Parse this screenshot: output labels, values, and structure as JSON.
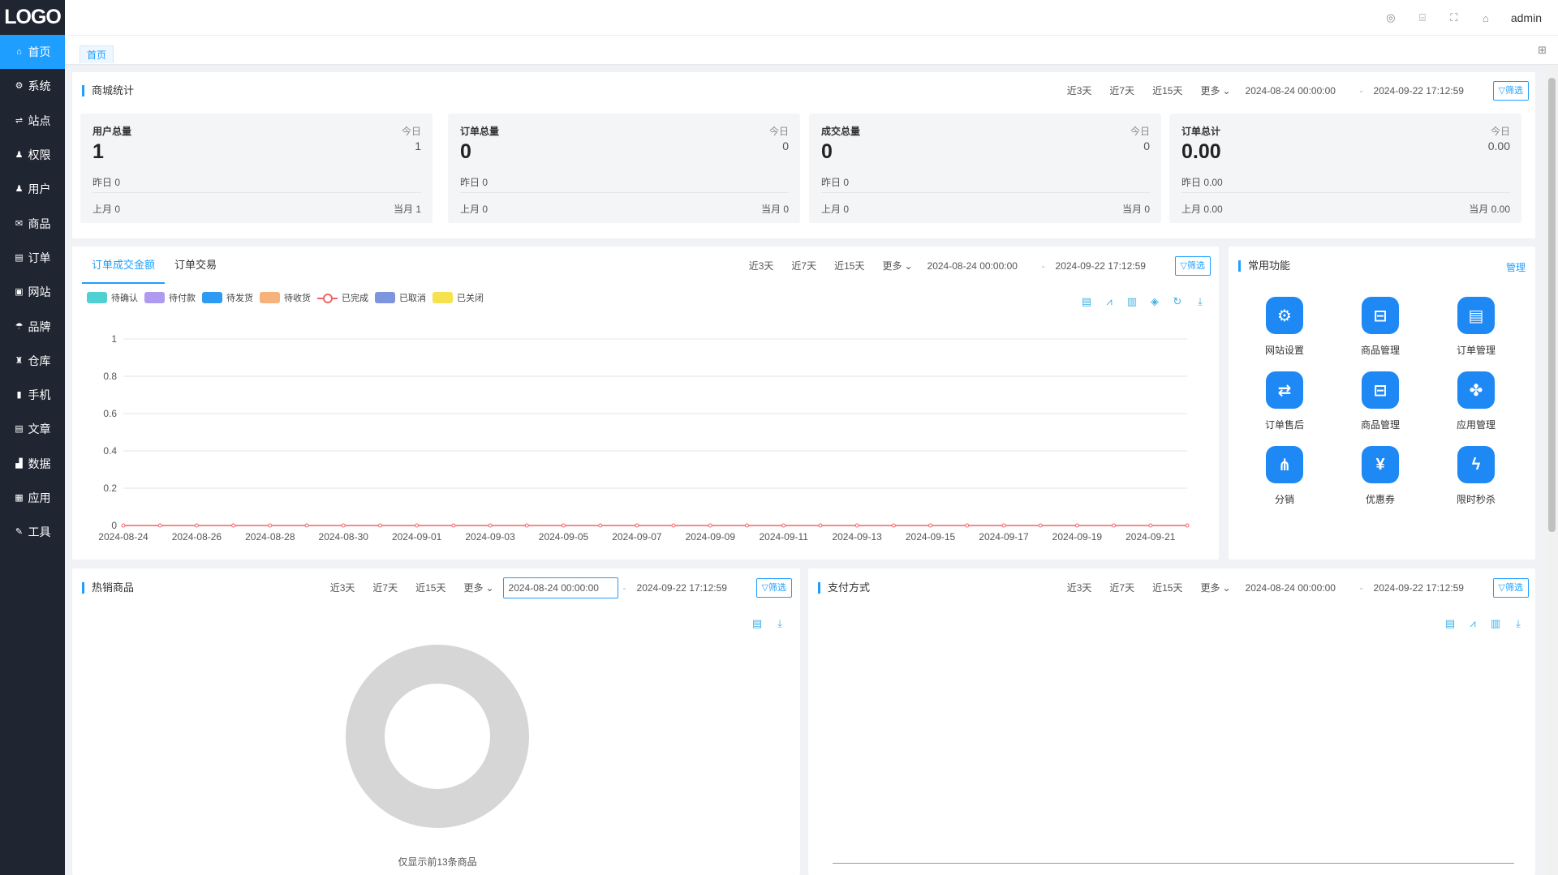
{
  "app": {
    "logo": "LOGO",
    "user": "admin"
  },
  "sidebar": {
    "items": [
      {
        "label": "首页",
        "icon": "⌂"
      },
      {
        "label": "系统",
        "icon": "⚙"
      },
      {
        "label": "站点",
        "icon": "⇌"
      },
      {
        "label": "权限",
        "icon": "♟"
      },
      {
        "label": "用户",
        "icon": "♟"
      },
      {
        "label": "商品",
        "icon": "✉"
      },
      {
        "label": "订单",
        "icon": "▤"
      },
      {
        "label": "网站",
        "icon": "▣"
      },
      {
        "label": "品牌",
        "icon": "☂"
      },
      {
        "label": "仓库",
        "icon": "♜"
      },
      {
        "label": "手机",
        "icon": "▮"
      },
      {
        "label": "文章",
        "icon": "▤"
      },
      {
        "label": "数据",
        "icon": "▟"
      },
      {
        "label": "应用",
        "icon": "▦"
      },
      {
        "label": "工具",
        "icon": "✎"
      }
    ]
  },
  "tabs": {
    "home": "首页"
  },
  "filters": {
    "d3": "近3天",
    "d7": "近7天",
    "d15": "近15天",
    "more": "更多",
    "start": "2024-08-24 00:00:00",
    "end": "2024-09-22 17:12:59",
    "sep": "-",
    "filter_btn": "筛选"
  },
  "mall_stats": {
    "title": "商城统计",
    "cards": [
      {
        "title": "用户总量",
        "today_label": "今日",
        "today": "1",
        "main": "1",
        "yesterday": "昨日   0",
        "last_month": "上月    0",
        "this_month": "当月    1"
      },
      {
        "title": "订单总量",
        "today_label": "今日",
        "today": "0",
        "main": "0",
        "yesterday": "昨日 0",
        "last_month": "上月    0",
        "this_month": "当月    0"
      },
      {
        "title": "成交总量",
        "today_label": "今日",
        "today": "0",
        "main": "0",
        "yesterday": "昨日 0",
        "last_month": "上月    0",
        "this_month": "当月    0"
      },
      {
        "title": "订单总计",
        "today_label": "今日",
        "today": "0.00",
        "main": "0.00",
        "yesterday": "昨日 0.00",
        "last_month": "上月    0.00",
        "this_month": "当月    0.00"
      }
    ]
  },
  "order_chart": {
    "tab1": "订单成交金额",
    "tab2": "订单交易",
    "legend": [
      {
        "name": "待确认",
        "color": "#4fd0d3"
      },
      {
        "name": "待付款",
        "color": "#b09af0"
      },
      {
        "name": "待发货",
        "color": "#2f9af2"
      },
      {
        "name": "待收货",
        "color": "#f7b27b"
      },
      {
        "name": "已完成",
        "color": "#ef6567",
        "type": "line"
      },
      {
        "name": "已取消",
        "color": "#7d94df"
      },
      {
        "name": "已关闭",
        "color": "#f6e14e"
      }
    ]
  },
  "chart_data": {
    "type": "line",
    "x": [
      "2024-08-24",
      "2024-08-25",
      "2024-08-26",
      "2024-08-27",
      "2024-08-28",
      "2024-08-29",
      "2024-08-30",
      "2024-08-31",
      "2024-09-01",
      "2024-09-02",
      "2024-09-03",
      "2024-09-04",
      "2024-09-05",
      "2024-09-06",
      "2024-09-07",
      "2024-09-08",
      "2024-09-09",
      "2024-09-10",
      "2024-09-11",
      "2024-09-12",
      "2024-09-13",
      "2024-09-14",
      "2024-09-15",
      "2024-09-16",
      "2024-09-17",
      "2024-09-18",
      "2024-09-19",
      "2024-09-20",
      "2024-09-21",
      "2024-09-22"
    ],
    "x_tick_labels": [
      "2024-08-24",
      "2024-08-26",
      "2024-08-28",
      "2024-08-30",
      "2024-09-01",
      "2024-09-03",
      "2024-09-05",
      "2024-09-07",
      "2024-09-09",
      "2024-09-11",
      "2024-09-13",
      "2024-09-15",
      "2024-09-17",
      "2024-09-19",
      "2024-09-21"
    ],
    "y_ticks": [
      "0",
      "0.2",
      "0.4",
      "0.6",
      "0.8",
      "1"
    ],
    "ylim": [
      0,
      1
    ],
    "grid": true,
    "series": [
      {
        "name": "已完成",
        "color": "#ef6567",
        "values": [
          0,
          0,
          0,
          0,
          0,
          0,
          0,
          0,
          0,
          0,
          0,
          0,
          0,
          0,
          0,
          0,
          0,
          0,
          0,
          0,
          0,
          0,
          0,
          0,
          0,
          0,
          0,
          0,
          0,
          0
        ]
      }
    ]
  },
  "quick": {
    "title": "常用功能",
    "manage": "管理",
    "items": [
      {
        "label": "网站设置",
        "icon": "gear-icon",
        "glyph": "⚙"
      },
      {
        "label": "商品管理",
        "icon": "bag-icon",
        "glyph": "⊟"
      },
      {
        "label": "订单管理",
        "icon": "document-icon",
        "glyph": "▤"
      },
      {
        "label": "订单售后",
        "icon": "swap-icon",
        "glyph": "⇄"
      },
      {
        "label": "商品管理",
        "icon": "bag-icon",
        "glyph": "⊟"
      },
      {
        "label": "应用管理",
        "icon": "grid-icon",
        "glyph": "✤"
      },
      {
        "label": "分销",
        "icon": "tree-icon",
        "glyph": "⋔"
      },
      {
        "label": "优惠券",
        "icon": "coupon-icon",
        "glyph": "¥"
      },
      {
        "label": "限时秒杀",
        "icon": "flash-icon",
        "glyph": "ϟ"
      }
    ]
  },
  "hot_goods": {
    "title": "热销商品",
    "note": "仅显示前13条商品"
  },
  "payment": {
    "title": "支付方式"
  }
}
